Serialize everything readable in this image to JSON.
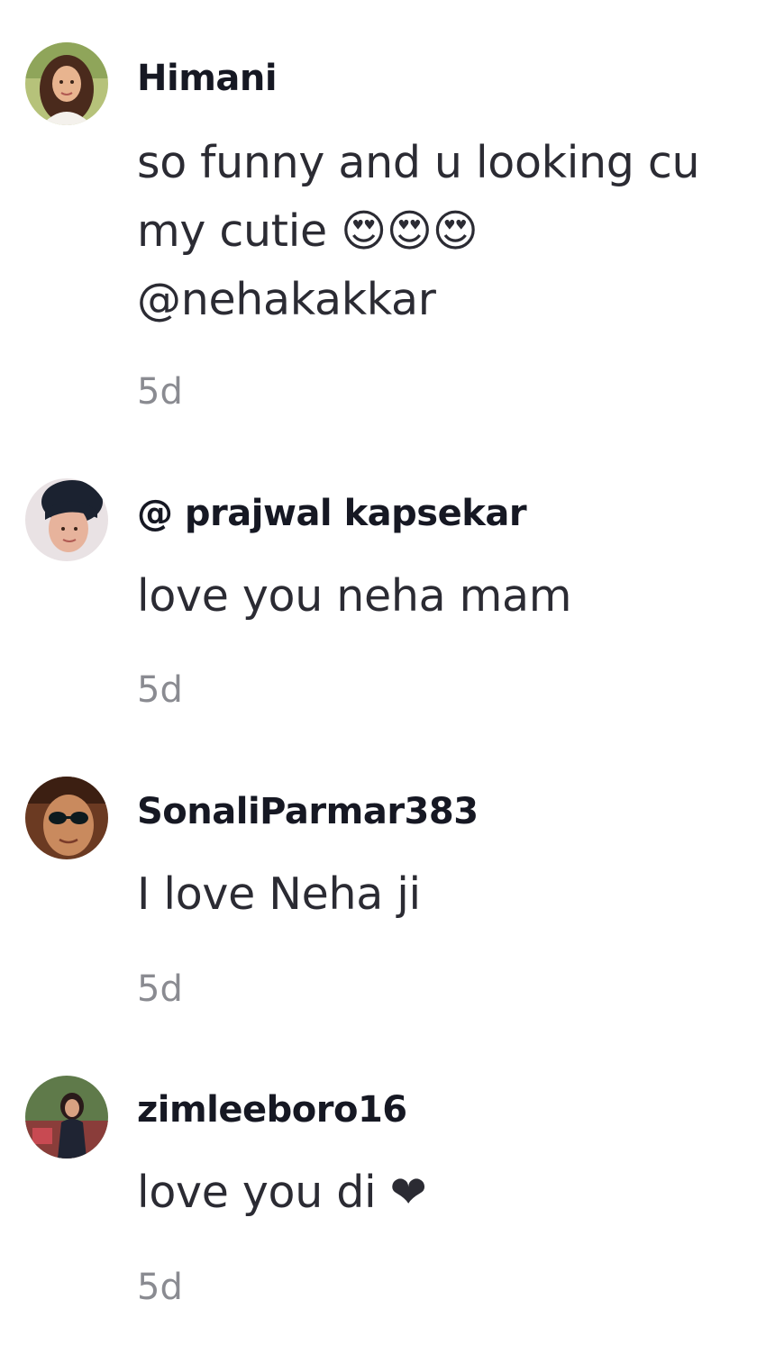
{
  "comments": [
    {
      "username": "Himani",
      "text": "so funny and u looking cu\nmy cutie 😍😍😍\n@nehakakkar",
      "timestamp": "5d",
      "avatar_icon": "avatar-photo-woman-icon"
    },
    {
      "username": "@ prajwal kapsekar",
      "text": "love you neha mam",
      "timestamp": "5d",
      "avatar_icon": "avatar-photo-person-icon"
    },
    {
      "username": "SonaliParmar383",
      "text": "I love Neha ji",
      "timestamp": "5d",
      "avatar_icon": "avatar-photo-sunglasses-icon"
    },
    {
      "username": "zimleeboro16",
      "text": "love you di ❤",
      "timestamp": "5d",
      "avatar_icon": "avatar-photo-woman-icon"
    }
  ]
}
